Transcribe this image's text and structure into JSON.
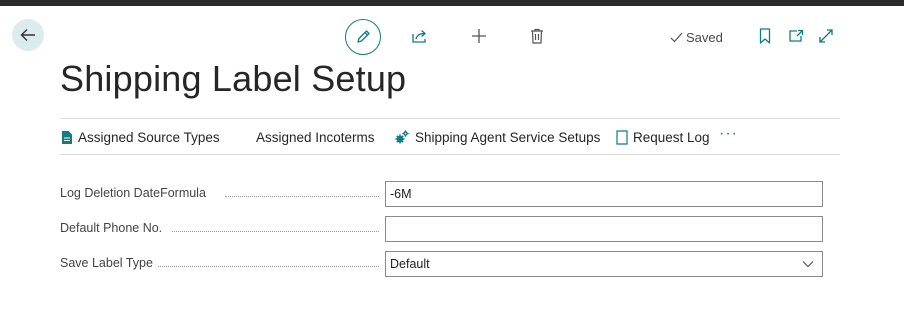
{
  "page": {
    "title": "Shipping Label Setup",
    "saved_status": "Saved"
  },
  "toolbar": {
    "back_icon": "arrow-left-icon",
    "edit_icon": "pencil-icon",
    "share_icon": "share-icon",
    "new_icon": "plus-icon",
    "delete_icon": "trash-icon",
    "saved_icon": "checkmark-icon",
    "bookmark_icon": "bookmark-icon",
    "popout_icon": "open-new-window-icon",
    "expand_icon": "expand-icon"
  },
  "actions": [
    {
      "label": "Assigned Source Types",
      "icon": "document-icon"
    },
    {
      "label": "Assigned Incoterms",
      "icon": ""
    },
    {
      "label": "Shipping Agent Service Setups",
      "icon": "gears-icon"
    },
    {
      "label": "Request Log",
      "icon": "log-page-icon"
    },
    {
      "label": "···",
      "icon": "more-options-icon"
    }
  ],
  "fields": [
    {
      "label": "Log Deletion DateFormula",
      "value": "-6M",
      "placeholder": ""
    },
    {
      "label": "Default Phone No.",
      "value": "",
      "placeholder": ""
    },
    {
      "label": "Save Label Type",
      "value": "Default",
      "options_selected": "Default"
    }
  ],
  "colors": {
    "accent": "#0f7d86",
    "back_button_bg": "#dcebef",
    "top_bar": "#2b2b2b"
  }
}
